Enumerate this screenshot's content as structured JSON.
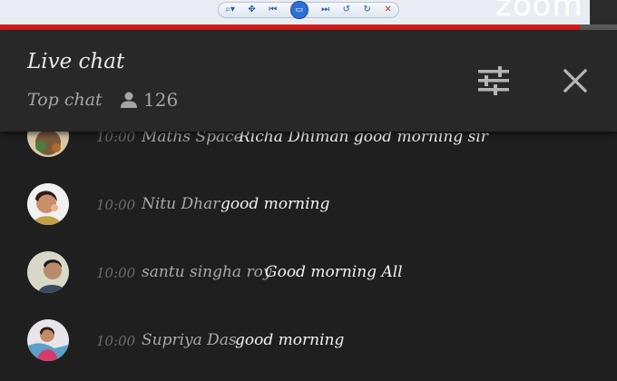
{
  "player": {
    "toolbar_icons": [
      "zoom-icon",
      "pan-icon",
      "prev-icon",
      "fit-icon",
      "next-icon",
      "undo-icon",
      "redo-icon",
      "close-icon"
    ],
    "logo_text": "zoom",
    "progress": 0.94,
    "progress_color": "#d21d1d"
  },
  "header": {
    "title": "Live chat",
    "mode": "Top chat",
    "viewer_count": "126"
  },
  "messages": [
    {
      "time": "10:00",
      "author": "Maths Space",
      "text": "Richa Dhiman good morning sir"
    },
    {
      "time": "10:00",
      "author": "Nitu Dhar",
      "text": "good morning"
    },
    {
      "time": "10:00",
      "author": "santu singha roy",
      "text": "Good morning All"
    },
    {
      "time": "10:00",
      "author": "Supriya Das",
      "text": "good morning"
    }
  ],
  "colors": {
    "background": "#1f1f1f",
    "header": "#282828",
    "accent_red": "#d21d1d"
  }
}
